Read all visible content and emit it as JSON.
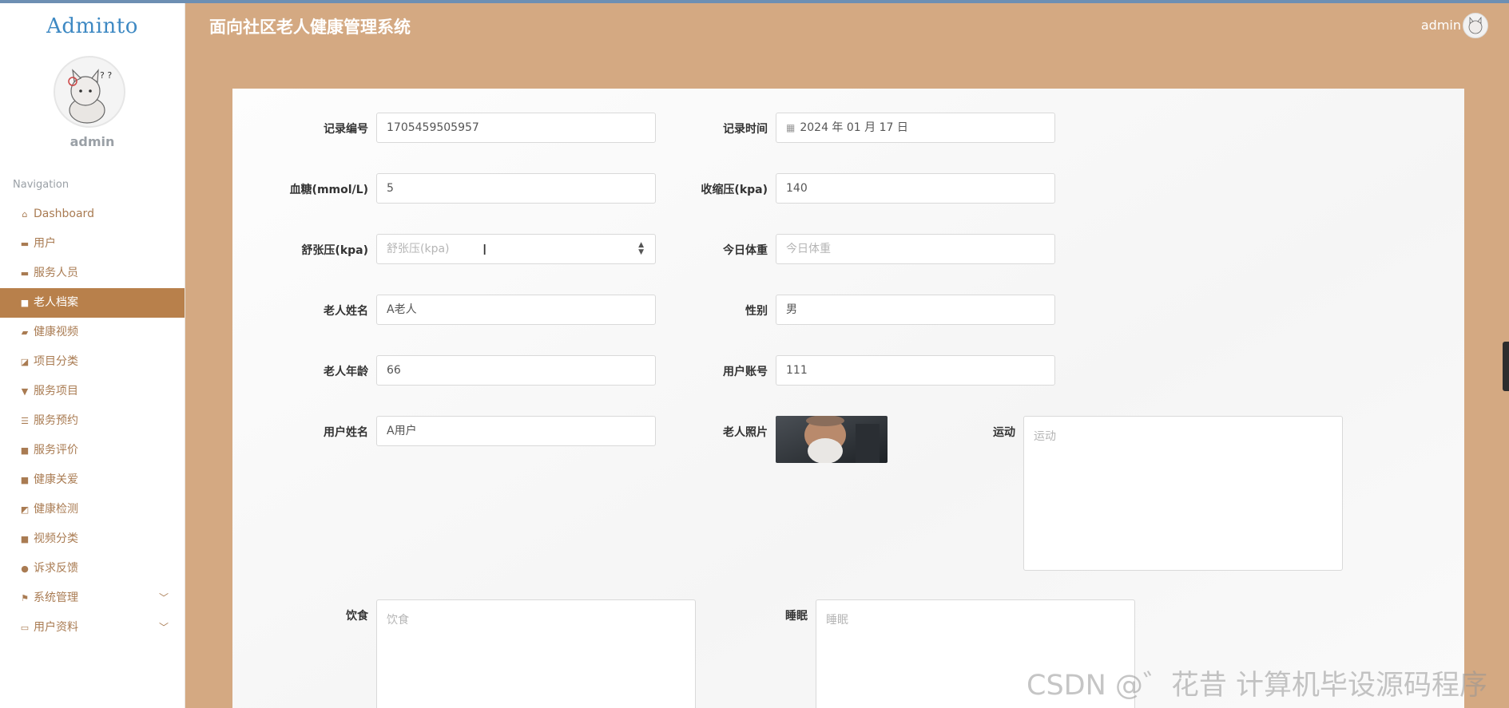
{
  "app": {
    "logo": "Adminto",
    "title": "面向社区老人健康管理系统",
    "header_user": "admin"
  },
  "sidebar": {
    "username": "admin",
    "nav_title": "Navigation",
    "items": [
      {
        "label": "Dashboard",
        "icon": "home-icon"
      },
      {
        "label": "用户",
        "icon": "monitor-icon"
      },
      {
        "label": "服务人员",
        "icon": "monitor-icon"
      },
      {
        "label": "老人档案",
        "icon": "grid-icon",
        "active": true
      },
      {
        "label": "健康视频",
        "icon": "briefcase-icon"
      },
      {
        "label": "项目分类",
        "icon": "chart-icon"
      },
      {
        "label": "服务项目",
        "icon": "pushpin-icon"
      },
      {
        "label": "服务预约",
        "icon": "list-icon"
      },
      {
        "label": "服务评价",
        "icon": "grid-icon"
      },
      {
        "label": "健康关爱",
        "icon": "grid-icon"
      },
      {
        "label": "健康检测",
        "icon": "wallet-icon"
      },
      {
        "label": "视频分类",
        "icon": "grid-icon"
      },
      {
        "label": "诉求反馈",
        "icon": "user-icon"
      },
      {
        "label": "系统管理",
        "icon": "flag-icon"
      },
      {
        "label": "用户资料",
        "icon": "card-icon"
      }
    ]
  },
  "form": {
    "record_no": {
      "label": "记录编号",
      "value": "1705459505957"
    },
    "record_time": {
      "label": "记录时间",
      "value": "2024 年 01 月 17 日"
    },
    "blood_sugar": {
      "label": "血糖(mmol/L)",
      "value": "5"
    },
    "systolic": {
      "label": "收缩压(kpa)",
      "value": "140"
    },
    "diastolic": {
      "label": "舒张压(kpa)",
      "placeholder": "舒张压(kpa)"
    },
    "weight": {
      "label": "今日体重",
      "placeholder": "今日体重"
    },
    "elder_name": {
      "label": "老人姓名",
      "value": "A老人"
    },
    "gender": {
      "label": "性别",
      "value": "男"
    },
    "elder_age": {
      "label": "老人年龄",
      "value": "66"
    },
    "user_account": {
      "label": "用户账号",
      "value": "111"
    },
    "user_name": {
      "label": "用户姓名",
      "value": "A用户"
    },
    "elder_photo": {
      "label": "老人照片"
    },
    "exercise": {
      "label": "运动",
      "placeholder": "运动"
    },
    "diet": {
      "label": "饮食",
      "placeholder": "饮食"
    },
    "sleep": {
      "label": "睡眠",
      "placeholder": "睡眠"
    }
  },
  "watermark": "CSDN @゛花昔 计算机毕设源码程序"
}
